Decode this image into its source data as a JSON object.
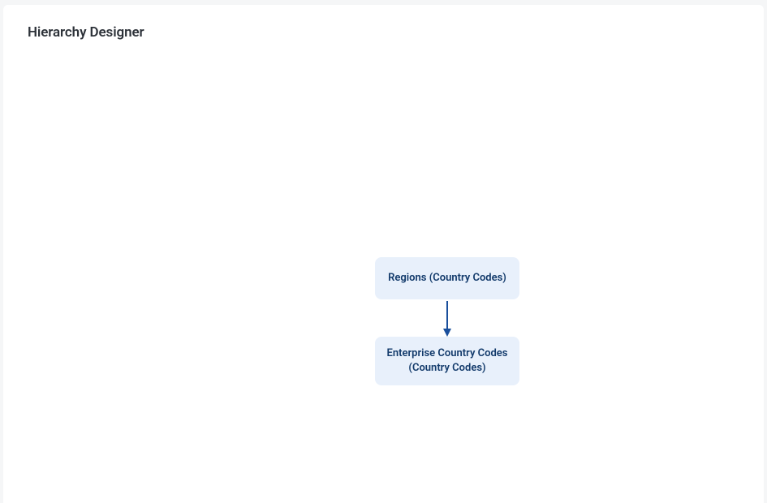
{
  "panel": {
    "title": "Hierarchy Designer"
  },
  "nodes": {
    "0": {
      "label": "Regions (Country Codes)"
    },
    "1": {
      "label": "Enterprise Country Codes (Country Codes)"
    }
  },
  "colors": {
    "node_bg": "#e8f0fb",
    "node_text": "#123a6b",
    "arrow": "#1a4f9c"
  }
}
